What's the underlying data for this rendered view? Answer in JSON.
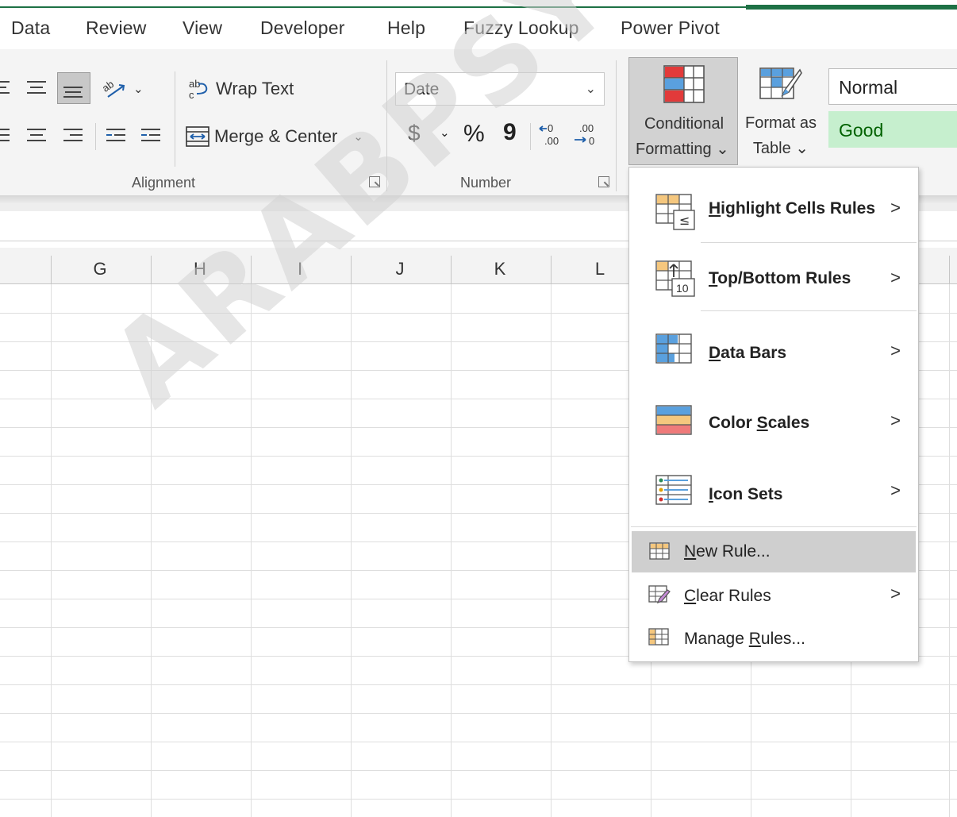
{
  "tabs": [
    "Data",
    "Review",
    "View",
    "Developer",
    "Help",
    "Fuzzy Lookup",
    "Power Pivot"
  ],
  "ribbon": {
    "alignment": {
      "wrap_text": "Wrap Text",
      "merge_center": "Merge & Center",
      "group_label": "Alignment"
    },
    "number": {
      "format_value": "Date",
      "currency": "$",
      "percent": "%",
      "comma": "9",
      "group_label": "Number"
    },
    "styles": {
      "conditional_formatting_line1": "Conditional",
      "conditional_formatting_line2": "Formatting",
      "format_as_table_line1": "Format as",
      "format_as_table_line2": "Table",
      "style_normal": "Normal",
      "style_good": "Good"
    }
  },
  "columns": [
    "G",
    "H",
    "I",
    "J",
    "K",
    "L"
  ],
  "watermark": "ARABPSYCHOLOGY.",
  "menu": {
    "items": [
      {
        "pre": "",
        "ul": "H",
        "post": "ighlight Cells Rules",
        "bold": true,
        "submenu": true
      },
      {
        "pre": "",
        "ul": "T",
        "post": "op/Bottom Rules",
        "bold": true,
        "submenu": true
      },
      {
        "pre": "",
        "ul": "D",
        "post": "ata Bars",
        "bold": true,
        "submenu": true
      },
      {
        "pre": "Color ",
        "ul": "S",
        "post": "cales",
        "bold": true,
        "submenu": true
      },
      {
        "pre": "",
        "ul": "I",
        "post": "con Sets",
        "bold": true,
        "submenu": true
      },
      {
        "pre": "",
        "ul": "N",
        "post": "ew Rule...",
        "bold": false,
        "submenu": false
      },
      {
        "pre": "",
        "ul": "C",
        "post": "lear Rules",
        "bold": false,
        "submenu": true
      },
      {
        "pre": "Manage ",
        "ul": "R",
        "post": "ules...",
        "bold": false,
        "submenu": false
      }
    ]
  },
  "colors": {
    "accent_green": "#1e7145",
    "good_fill": "#c6efce",
    "good_text": "#006100",
    "menu_hover": "#cfcfcf"
  }
}
